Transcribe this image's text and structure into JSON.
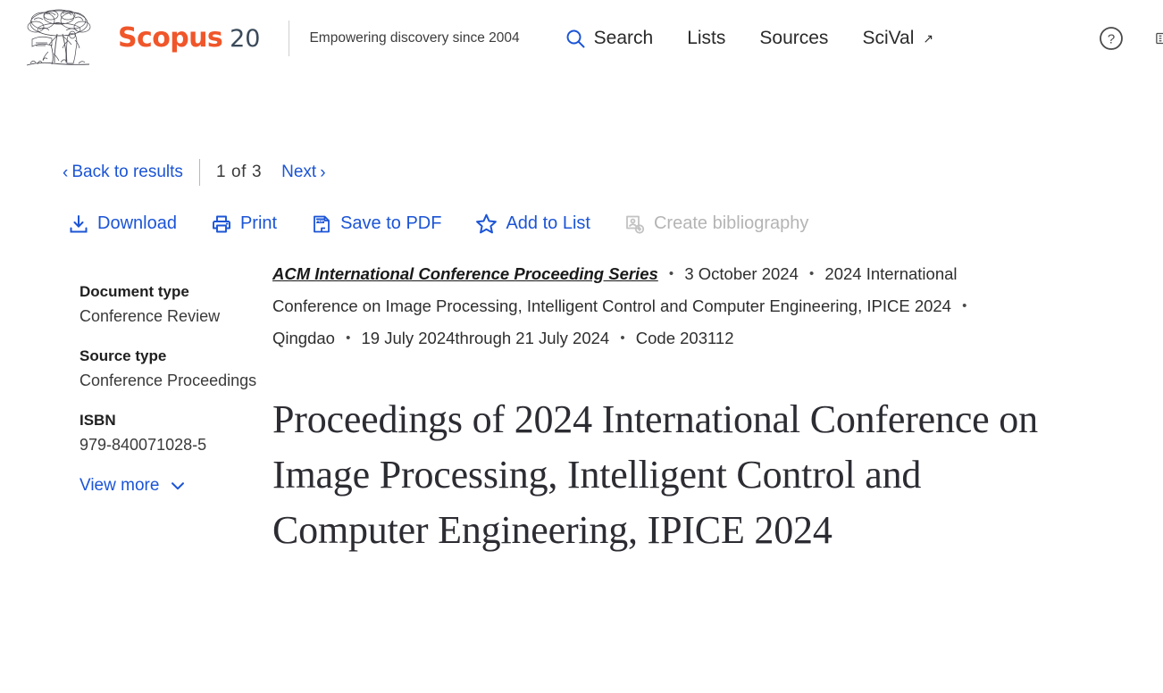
{
  "header": {
    "logo_alt": "elsevier-tree-logo",
    "brand_name": "Scopus",
    "brand_badge": "20",
    "tagline": "Empowering discovery since 2004",
    "brand_color": "#F0562A",
    "link_color": "#1b54d6",
    "nav": [
      {
        "label": "Search",
        "icon": "search-icon"
      },
      {
        "label": "Lists",
        "icon": ""
      },
      {
        "label": "Sources",
        "icon": ""
      },
      {
        "label": "SciVal",
        "icon": "external-link-icon",
        "external": "↗"
      }
    ],
    "help_icon": "help-circle-icon",
    "account_icon": "institution-icon"
  },
  "results_nav": {
    "back_label": "Back to results",
    "back_chevron": "‹",
    "current_page": "1",
    "of_label": "of",
    "total_pages": "3",
    "next_label": "Next",
    "next_chevron": "›"
  },
  "toolbar": [
    {
      "label": "Download",
      "icon": "download-icon",
      "disabled": false
    },
    {
      "label": "Print",
      "icon": "printer-icon",
      "disabled": false
    },
    {
      "label": "Save to PDF",
      "icon": "pdf-icon",
      "disabled": false
    },
    {
      "label": "Add to List",
      "icon": "star-icon",
      "disabled": false
    },
    {
      "label": "Create bibliography",
      "icon": "bibliography-icon",
      "disabled": true
    }
  ],
  "source": {
    "name": "ACM International Conference Proceeding Series",
    "date": "3 October 2024",
    "conference": "2024 International Conference on Image Processing, Intelligent Control and Computer Engineering, IPICE 2024",
    "location": "Qingdao",
    "dates": "19 July 2024through 21 July 2024",
    "code": "Code 203112",
    "separator": "•"
  },
  "document": {
    "title": "Proceedings of 2024 International Conference on Image Processing, Intelligent Control and Computer Engineering, IPICE 2024"
  },
  "sidebar": {
    "fields": [
      {
        "label": "Document type",
        "value": "Conference Review"
      },
      {
        "label": "Source type",
        "value": "Conference Proceedings"
      },
      {
        "label": "ISBN",
        "value": "979-840071028-5"
      }
    ],
    "view_more_label": "View more",
    "view_more_icon": "chevron-down-icon"
  }
}
